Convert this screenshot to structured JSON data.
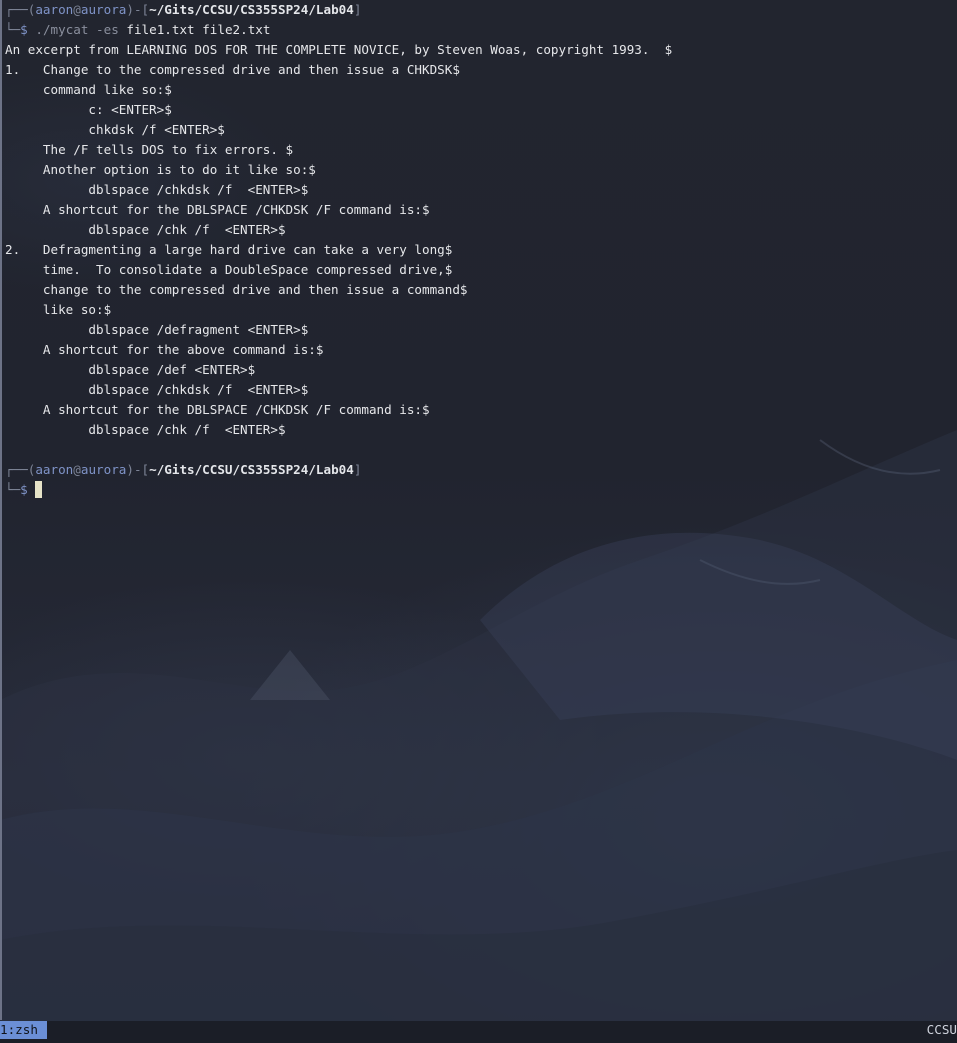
{
  "prompt1": {
    "top_frame": "┌──(",
    "user": "aaron",
    "at": "@",
    "host": "aurora",
    "mid": ")-[",
    "path": "~/Gits/CCSU/CS355SP24/Lab04",
    "close": "]",
    "bottom_frame": "└─",
    "dollar": "$",
    "command": "./mycat",
    "flag": "-es",
    "args": "file1.txt file2.txt"
  },
  "output": [
    "An excerpt from LEARNING DOS FOR THE COMPLETE NOVICE, by Steven Woas, copyright 1993.  $",
    "1.   Change to the compressed drive and then issue a CHKDSK$",
    "     command like so:$",
    "           c: <ENTER>$",
    "           chkdsk /f <ENTER>$",
    "     The /F tells DOS to fix errors. $",
    "     Another option is to do it like so:$",
    "           dblspace /chkdsk /f  <ENTER>$",
    "     A shortcut for the DBLSPACE /CHKDSK /F command is:$",
    "           dblspace /chk /f  <ENTER>$",
    "2.   Defragmenting a large hard drive can take a very long$",
    "     time.  To consolidate a DoubleSpace compressed drive,$",
    "     change to the compressed drive and then issue a command$",
    "     like so:$",
    "           dblspace /defragment <ENTER>$",
    "     A shortcut for the above command is:$",
    "           dblspace /def <ENTER>$",
    "           dblspace /chkdsk /f  <ENTER>$",
    "     A shortcut for the DBLSPACE /CHKDSK /F command is:$",
    "           dblspace /chk /f  <ENTER>$"
  ],
  "prompt2": {
    "top_frame": "┌──(",
    "user": "aaron",
    "at": "@",
    "host": "aurora",
    "mid": ")-[",
    "path": "~/Gits/CCSU/CS355SP24/Lab04",
    "close": "]",
    "bottom_frame": "└─",
    "dollar": "$"
  },
  "statusbar": {
    "window_label": "1:zsh",
    "session_name": "CCSU"
  },
  "colors": {
    "accent": "#7f93c7",
    "status_tab": "#6b8fd6",
    "background": "#1f2230",
    "cursor": "#e6e3c8"
  }
}
